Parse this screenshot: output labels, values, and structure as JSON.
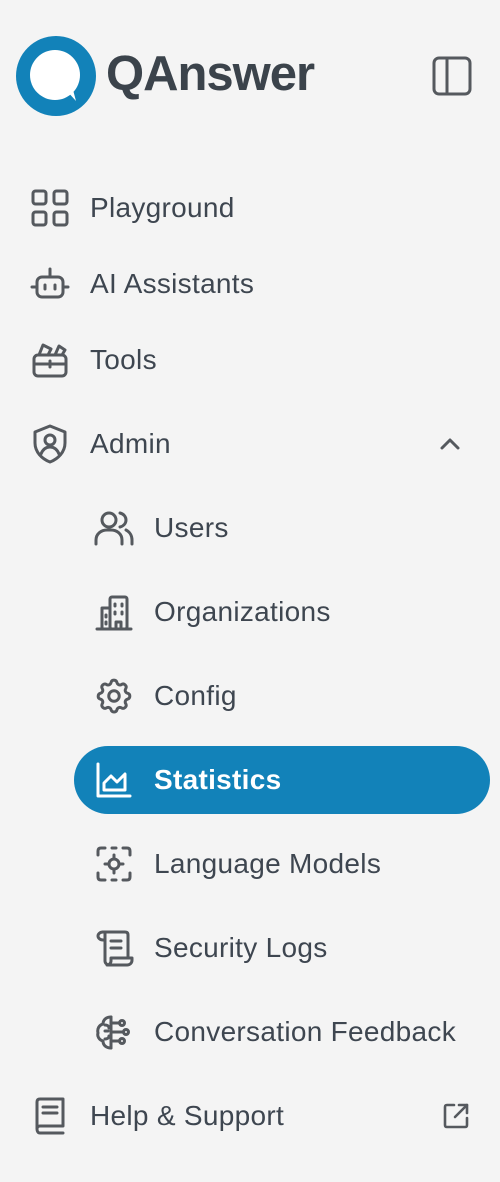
{
  "brand": {
    "name": "QAnswer"
  },
  "colors": {
    "accent": "#1282b9",
    "text": "#3e4650",
    "icon": "#55595e",
    "background": "#f4f4f4"
  },
  "nav": {
    "playground": {
      "label": "Playground",
      "icon": "grid-icon"
    },
    "ai_assistants": {
      "label": "AI Assistants",
      "icon": "robot-icon"
    },
    "tools": {
      "label": "Tools",
      "icon": "toolbox-icon"
    },
    "admin": {
      "label": "Admin",
      "icon": "shield-user-icon",
      "expanded": true,
      "children": [
        {
          "label": "Users",
          "icon": "users-icon"
        },
        {
          "label": "Organizations",
          "icon": "building-icon"
        },
        {
          "label": "Config",
          "icon": "gear-icon"
        },
        {
          "label": "Statistics",
          "icon": "chart-icon",
          "active": true
        },
        {
          "label": "Language Models",
          "icon": "model-chip-icon"
        },
        {
          "label": "Security Logs",
          "icon": "scroll-icon"
        },
        {
          "label": "Conversation Feedback",
          "icon": "brain-icon"
        }
      ]
    },
    "help": {
      "label": "Help & Support",
      "icon": "book-icon",
      "external": true
    }
  }
}
